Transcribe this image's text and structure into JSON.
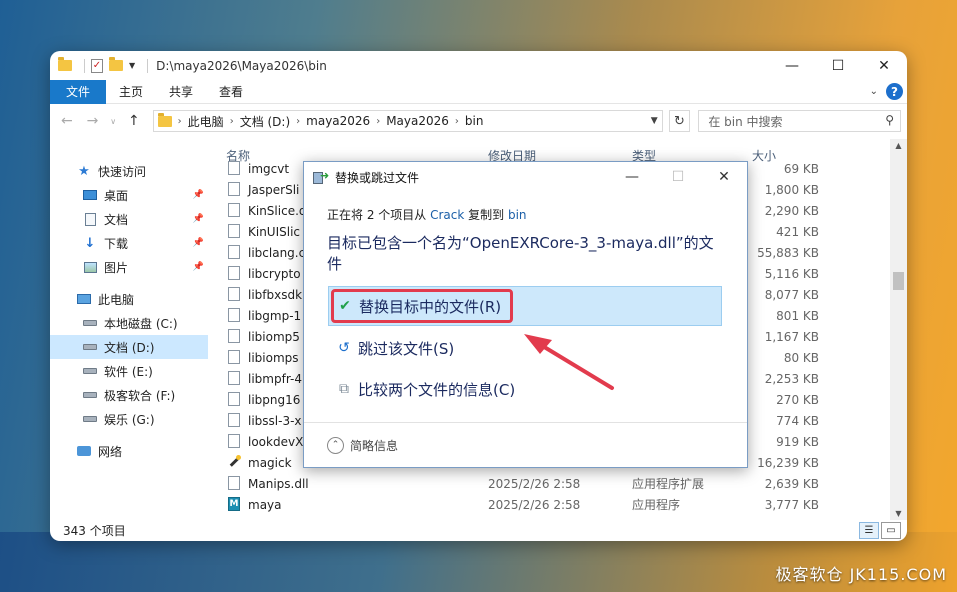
{
  "window": {
    "title_path": "D:\\maya2026\\Maya2026\\bin",
    "controls": [
      "—",
      "☐",
      "✕"
    ]
  },
  "ribbon": {
    "tabs": [
      "文件",
      "主页",
      "共享",
      "查看"
    ]
  },
  "address": {
    "crumbs": [
      "此电脑",
      "文档 (D:)",
      "maya2026",
      "Maya2026",
      "bin"
    ],
    "search_placeholder": "在 bin 中搜索"
  },
  "sidebar": {
    "items": [
      {
        "label": "快速访问",
        "icon": "star-icon",
        "sub": false
      },
      {
        "label": "桌面",
        "icon": "desktop-icon",
        "sub": true,
        "pinned": true
      },
      {
        "label": "文档",
        "icon": "documents-icon",
        "sub": true,
        "pinned": true
      },
      {
        "label": "下载",
        "icon": "download-icon",
        "sub": true,
        "pinned": true
      },
      {
        "label": "图片",
        "icon": "pictures-icon",
        "sub": true,
        "pinned": true
      },
      {
        "label": "此电脑",
        "icon": "computer-icon",
        "sub": false
      },
      {
        "label": "本地磁盘 (C:)",
        "icon": "drive-icon",
        "sub": true
      },
      {
        "label": "文档 (D:)",
        "icon": "drive-icon",
        "sub": true,
        "selected": true
      },
      {
        "label": "软件 (E:)",
        "icon": "drive-icon",
        "sub": true
      },
      {
        "label": "极客软合 (F:)",
        "icon": "drive-icon",
        "sub": true
      },
      {
        "label": "娱乐 (G:)",
        "icon": "drive-icon",
        "sub": true
      },
      {
        "label": "网络",
        "icon": "network-icon",
        "sub": false
      }
    ]
  },
  "columns": {
    "name": "名称",
    "date": "修改日期",
    "type": "类型",
    "size": "大小"
  },
  "files": [
    {
      "name": "imgcvt",
      "date": "",
      "type": "",
      "size": "69 KB"
    },
    {
      "name": "JasperSli",
      "date": "",
      "type": "",
      "size": "1,800 KB"
    },
    {
      "name": "KinSlice.d",
      "date": "",
      "type": "",
      "size": "2,290 KB"
    },
    {
      "name": "KinUISlic",
      "date": "",
      "type": "",
      "size": "421 KB"
    },
    {
      "name": "libclang.c",
      "date": "",
      "type": "",
      "size": "55,883 KB"
    },
    {
      "name": "libcrypto",
      "date": "",
      "type": "",
      "size": "5,116 KB"
    },
    {
      "name": "libfbxsdk",
      "date": "",
      "type": "",
      "size": "8,077 KB"
    },
    {
      "name": "libgmp-1",
      "date": "",
      "type": "",
      "size": "801 KB"
    },
    {
      "name": "libiomp5",
      "date": "",
      "type": "",
      "size": "1,167 KB"
    },
    {
      "name": "libiomps",
      "date": "",
      "type": "",
      "size": "80 KB"
    },
    {
      "name": "libmpfr-4",
      "date": "",
      "type": "",
      "size": "2,253 KB"
    },
    {
      "name": "libpng16",
      "date": "",
      "type": "",
      "size": "270 KB"
    },
    {
      "name": "libssl-3-x",
      "date": "",
      "type": "",
      "size": "774 KB"
    },
    {
      "name": "lookdevX",
      "date": "",
      "type": "",
      "size": "919 KB"
    },
    {
      "name": "magick",
      "date": "",
      "type": "",
      "size": "16,239 KB"
    },
    {
      "name": "Manips.dll",
      "date": "2025/2/26 2:58",
      "type": "应用程序扩展",
      "size": "2,639 KB"
    },
    {
      "name": "maya",
      "date": "2025/2/26 2:58",
      "type": "应用程序",
      "size": "3,777 KB"
    }
  ],
  "status": {
    "count": "343 个项目"
  },
  "dialog": {
    "title": "替换或跳过文件",
    "line_prefix": "正在将 2 个项目从",
    "source": "Crack",
    "line_mid": "复制到",
    "dest": "bin",
    "heading": "目标已包含一个名为“OpenEXRCore-3_3-maya.dll”的文件",
    "option_replace": "替换目标中的文件(R)",
    "option_skip": "跳过该文件(S)",
    "option_compare": "比较两个文件的信息(C)",
    "details": "简略信息"
  },
  "watermark": "极客软仓 JK115.COM",
  "colors": {
    "accent": "#1979ca",
    "highlight": "#e23b4d",
    "selection": "#cde8fb"
  }
}
